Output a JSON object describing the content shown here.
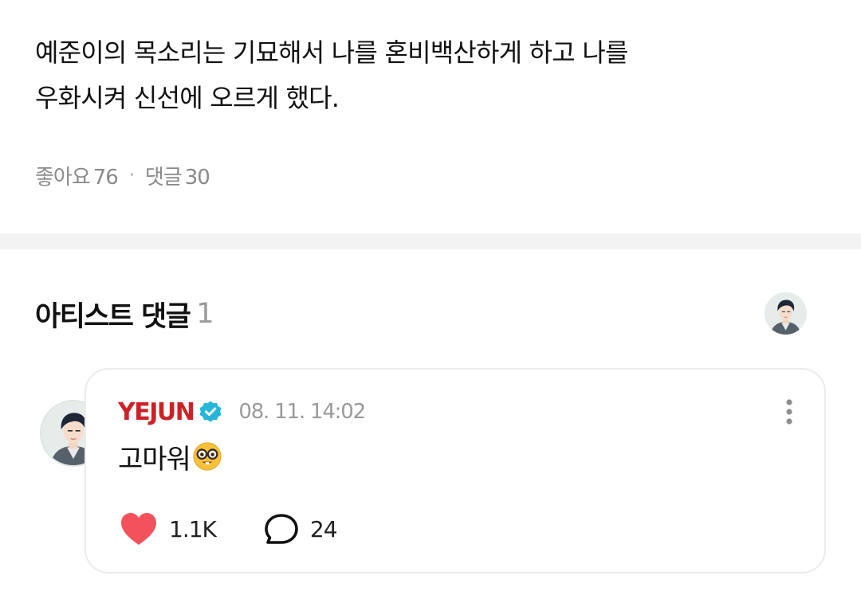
{
  "post": {
    "body_lines": [
      "예준이의 목소리는 기묘해서 나를 혼비백산하게 하고 나를",
      "우화시켜 신선에 오르게 했다."
    ],
    "likes_label": "좋아요",
    "likes_count": "76",
    "separator": "·",
    "comments_label": "댓글",
    "comments_count": "30"
  },
  "artist_comments": {
    "title": "아티스트 댓글",
    "count": "1",
    "items": [
      {
        "author": "YEJUN",
        "date": "08. 11. 14:02",
        "text": "고마워",
        "emoji": "nerd-face-icon",
        "like_count": "1.1K",
        "reply_count": "24"
      }
    ]
  },
  "colors": {
    "author_name": "#cc2227",
    "verified_badge": "#27b6d9",
    "heart": "#f4525b",
    "divider_band": "#f3f3f3"
  },
  "icons": {
    "verified": "verified-badge-icon",
    "more": "more-vertical-icon",
    "like": "heart-icon",
    "reply": "speech-bubble-icon"
  }
}
